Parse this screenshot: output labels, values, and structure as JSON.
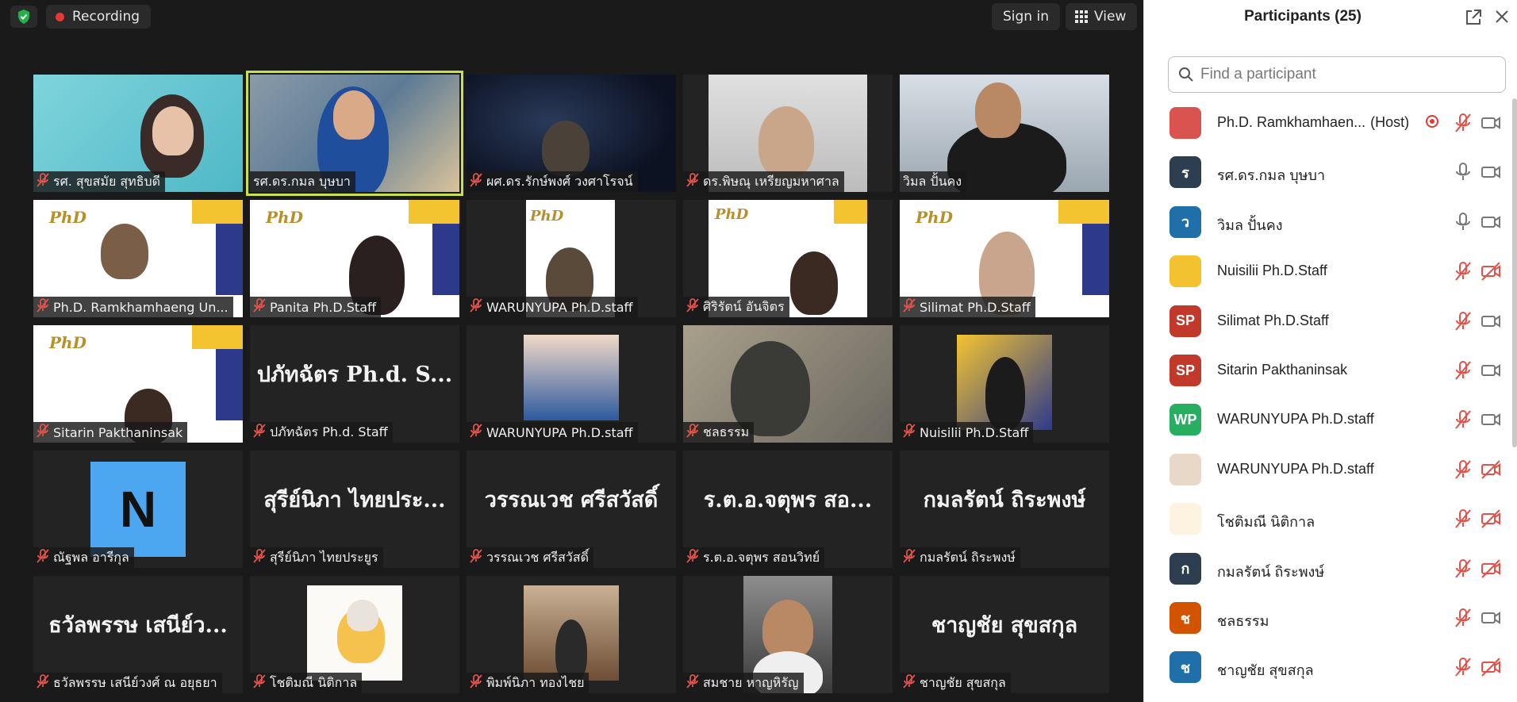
{
  "toolbar": {
    "recording_label": "Recording",
    "sign_in_label": "Sign in",
    "view_label": "View"
  },
  "tiles": [
    {
      "name": "รศ. สุขสมัย สุทธิบดี",
      "muted": true
    },
    {
      "name": "รศ.ดร.กมล บุษบา",
      "muted": false
    },
    {
      "name": "ผศ.ดร.รักษ์พงศ์ วงศาโรจน์",
      "muted": true
    },
    {
      "name": "ดร.พิษณุ เหรียญมหาศาล",
      "muted": true
    },
    {
      "name": "วิมล ปั้นคง",
      "muted": false
    },
    {
      "name": "Ph.D. Ramkhamhaeng Un...",
      "muted": true
    },
    {
      "name": "Panita Ph.D.Staff",
      "muted": true
    },
    {
      "name": "WARUNYUPA Ph.D.staff",
      "muted": true
    },
    {
      "name": "ศิริรัตน์ อันจิตร",
      "muted": true
    },
    {
      "name": "Silimat Ph.D.Staff",
      "muted": true
    },
    {
      "name": "Sitarin Pakthaninsak",
      "muted": true
    },
    {
      "name": "ปภัทฉัตร Ph.d. Staff",
      "muted": true,
      "display": "ปภัทฉัตร Ph.d. S..."
    },
    {
      "name": "WARUNYUPA Ph.D.staff",
      "muted": true
    },
    {
      "name": "ชลธรรม",
      "muted": true
    },
    {
      "name": "Nuisilii Ph.D.Staff",
      "muted": true
    },
    {
      "name": "ณัฐพล อารีกุล",
      "muted": true,
      "letter": "N"
    },
    {
      "name": "สุรีย์นิภา ไทยประยูร",
      "muted": true,
      "display": "สุรีย์นิภา ไทยประ..."
    },
    {
      "name": "วรรณเวช ศรีสวัสดิ์",
      "muted": true,
      "display": "วรรณเวช ศรีสวัสดิ์"
    },
    {
      "name": "ร.ต.อ.จตุพร  สอนวิทย์",
      "muted": true,
      "display": "ร.ต.อ.จตุพร  สอ..."
    },
    {
      "name": "กมลรัตน์ ถิระพงษ์",
      "muted": true,
      "display": "กมลรัตน์ ถิระพงษ์"
    },
    {
      "name": "ธวัลพรรษ เสนีย์วงศ์ ณ อยุธยา",
      "muted": true,
      "display": "ธวัลพรรษ เสนีย์ว..."
    },
    {
      "name": "โชติมณี นิติกาล",
      "muted": true
    },
    {
      "name": "พิมพ์นิภา ทองไชย",
      "muted": true
    },
    {
      "name": "สมชาย หาญหิรัญ",
      "muted": true
    },
    {
      "name": "ชาญชัย สุขสกุล",
      "muted": true,
      "display": "ชาญชัย สุขสกุล"
    }
  ],
  "panel": {
    "title": "Participants (25)",
    "search_placeholder": "Find a participant"
  },
  "participants": [
    {
      "name": "Ph.D. Ramkhamhaen...",
      "host_tag": "(Host)",
      "avatar_text": "",
      "avatar_color": "#d9534f",
      "mic": "off",
      "cam": "on",
      "recording": true
    },
    {
      "name": "รศ.ดร.กมล บุษบา",
      "avatar_text": "ร",
      "avatar_color": "#2c3e50",
      "mic": "on",
      "cam": "on"
    },
    {
      "name": "วิมล ปั้นคง",
      "avatar_text": "ว",
      "avatar_color": "#1f6fa8",
      "mic": "on",
      "cam": "on"
    },
    {
      "name": "Nuisilii Ph.D.Staff",
      "avatar_text": "",
      "avatar_color": "#f2c230",
      "mic": "off",
      "cam": "off"
    },
    {
      "name": "Silimat Ph.D.Staff",
      "avatar_text": "SP",
      "avatar_color": "#c0392b",
      "mic": "off",
      "cam": "on"
    },
    {
      "name": "Sitarin Pakthaninsak",
      "avatar_text": "SP",
      "avatar_color": "#c0392b",
      "mic": "off",
      "cam": "on"
    },
    {
      "name": "WARUNYUPA Ph.D.staff",
      "avatar_text": "WP",
      "avatar_color": "#27ae60",
      "mic": "off",
      "cam": "on"
    },
    {
      "name": "WARUNYUPA Ph.D.staff",
      "avatar_text": "",
      "avatar_color": "#e8d8c8",
      "mic": "off",
      "cam": "off"
    },
    {
      "name": "โชติมณี นิติกาล",
      "avatar_text": "",
      "avatar_color": "#fdf3e0",
      "mic": "off",
      "cam": "off"
    },
    {
      "name": "กมลรัตน์ ถิระพงษ์",
      "avatar_text": "ก",
      "avatar_color": "#2c3e50",
      "mic": "off",
      "cam": "off"
    },
    {
      "name": "ชลธรรม",
      "avatar_text": "ช",
      "avatar_color": "#d35400",
      "mic": "off",
      "cam": "on"
    },
    {
      "name": "ชาญชัย สุขสกุล",
      "avatar_text": "ช",
      "avatar_color": "#1f6fa8",
      "mic": "off",
      "cam": "off"
    }
  ]
}
